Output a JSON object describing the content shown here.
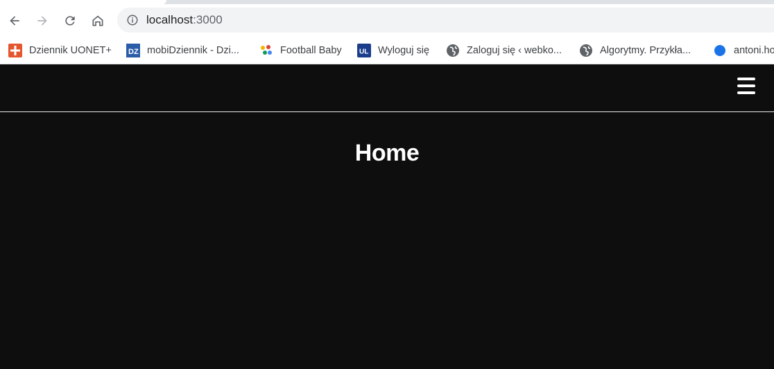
{
  "browser": {
    "url_host": "localhost",
    "url_port": ":3000",
    "nav": {
      "back_icon": "back-arrow-icon",
      "forward_icon": "forward-arrow-icon",
      "reload_icon": "reload-icon",
      "home_icon": "home-icon"
    }
  },
  "bookmarks": [
    {
      "label": "Dziennik UONET+",
      "icon": "uonet-icon",
      "color": "#e4572e"
    },
    {
      "label": "mobiDziennik - Dzi...",
      "icon": "mobidziennik-icon",
      "color": "#2a5ca8"
    },
    {
      "label": "Football Baby",
      "icon": "football-baby-icon",
      "color": "#f4b400"
    },
    {
      "label": "Wyloguj się",
      "icon": "ul-icon",
      "color": "#1a3e8c"
    },
    {
      "label": "Zaloguj się ‹ webko...",
      "icon": "globe-icon",
      "color": "#5f6368"
    },
    {
      "label": "Algorytmy. Przykła...",
      "icon": "globe-icon",
      "color": "#5f6368"
    },
    {
      "label": "antoni.ho",
      "icon": "blue-dot-icon",
      "color": "#1a73e8"
    }
  ],
  "app": {
    "menu_icon": "hamburger-menu-icon",
    "title": "Home",
    "background": "#0e0e0e",
    "text_color": "#ffffff"
  }
}
